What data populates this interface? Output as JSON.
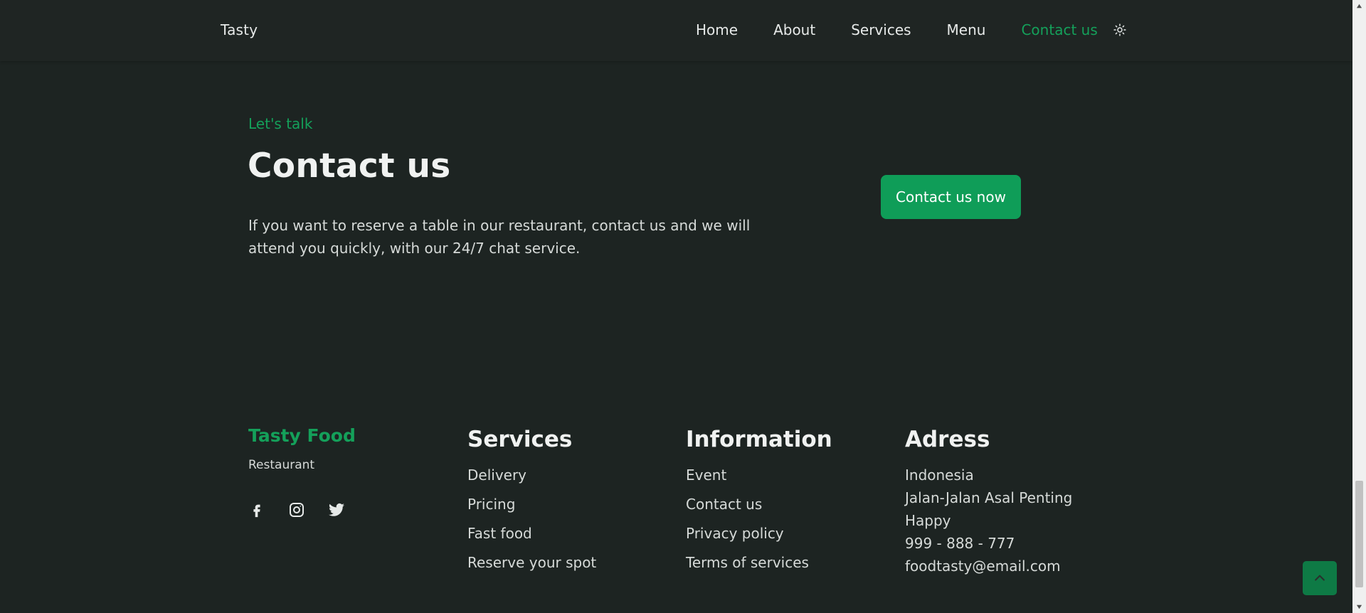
{
  "header": {
    "logo": "Tasty",
    "nav": [
      {
        "label": "Home"
      },
      {
        "label": "About"
      },
      {
        "label": "Services"
      },
      {
        "label": "Menu"
      },
      {
        "label": "Contact us"
      }
    ],
    "active_nav": "Contact us",
    "theme_icon": "sun-icon"
  },
  "contact": {
    "subtitle": "Let's talk",
    "title": "Contact us",
    "description": "If you want to reserve a table in our restaurant, contact us and we will attend you quickly, with our 24/7 chat service.",
    "button_label": "Contact us now"
  },
  "footer": {
    "brand": "Tasty Food",
    "brand_sub": "Restaurant",
    "socials": [
      "facebook-icon",
      "instagram-icon",
      "twitter-icon"
    ],
    "services": {
      "title": "Services",
      "items": [
        "Delivery",
        "Pricing",
        "Fast food",
        "Reserve your spot"
      ]
    },
    "information": {
      "title": "Information",
      "items": [
        "Event",
        "Contact us",
        "Privacy policy",
        "Terms of services"
      ]
    },
    "address": {
      "title": "Adress",
      "lines": [
        "Indonesia",
        "Jalan-Jalan Asal Penting",
        "Happy",
        "999 - 888 - 777",
        "foodtasty@email.com"
      ]
    }
  },
  "colors": {
    "background": "#1d2422",
    "accent": "#14a05a",
    "button": "#0f9d58"
  }
}
